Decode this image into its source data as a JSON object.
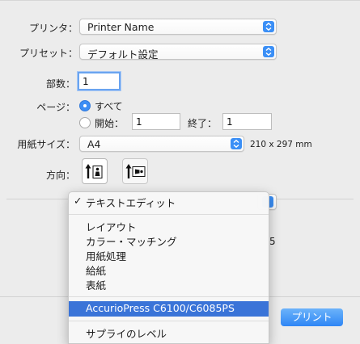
{
  "dialog": {
    "printer_label": "プリンタ：",
    "printer_value": "Printer Name",
    "preset_label": "プリセット：",
    "preset_value": "デフォルト設定",
    "copies_label": "部数：",
    "copies_value": "1",
    "pages_label": "ページ：",
    "pages_all_label": "すべて",
    "pages_range_label": "開始：",
    "pages_from_value": "1",
    "pages_to_label": "終了：",
    "pages_to_value": "1",
    "paper_label": "用紙サイズ：",
    "paper_value": "A4",
    "paper_dimensions": "210 x 297 mm",
    "orientation_label": "方向：",
    "background_number": "5",
    "print_button": "プリント"
  },
  "menu": {
    "checked_item": "テキストエディット",
    "items": [
      "レイアウト",
      "カラー・マッチング",
      "用紙処理",
      "給紙",
      "表紙"
    ],
    "highlighted_item": "AccurioPress C6100/C6085PS",
    "last_item": "サプライのレベル"
  },
  "colors": {
    "accent": "#3b8ff6",
    "menu_highlight": "#3a74d8",
    "background": "#ececec"
  }
}
